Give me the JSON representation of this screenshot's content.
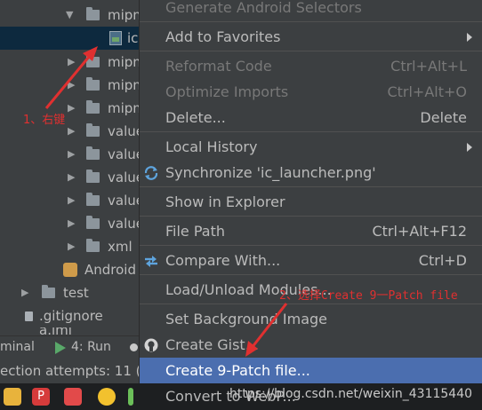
{
  "project_tree": {
    "rows": [
      {
        "label": "mipm"
      },
      {
        "label": "ic"
      },
      {
        "label": "mipm"
      },
      {
        "label": "mipm"
      },
      {
        "label": "mipm"
      },
      {
        "label": "value"
      },
      {
        "label": "value"
      },
      {
        "label": "value"
      },
      {
        "label": "value"
      },
      {
        "label": "value"
      },
      {
        "label": "xml"
      },
      {
        "label": "Android"
      },
      {
        "label": "test"
      },
      {
        "label": ".gitignore"
      },
      {
        "label": "a.iml"
      }
    ]
  },
  "tool_strip": {
    "terminal": "minal",
    "run": "4: Run"
  },
  "status_bar": {
    "text": "ection attempts: 11 ("
  },
  "context_menu": {
    "items": [
      {
        "label": "Generate Android Selectors",
        "enabled": false
      },
      {
        "label": "Add to Favorites",
        "submenu": true
      },
      {
        "label": "Reformat Code",
        "shortcut": "Ctrl+Alt+L",
        "enabled": false
      },
      {
        "label": "Optimize Imports",
        "shortcut": "Ctrl+Alt+O",
        "enabled": false
      },
      {
        "label": "Delete...",
        "shortcut": "Delete"
      },
      {
        "label": "Local History",
        "submenu": true
      },
      {
        "label": "Synchronize 'ic_launcher.png'",
        "icon": "sync-icon"
      },
      {
        "label": "Show in Explorer"
      },
      {
        "label": "File Path",
        "shortcut": "Ctrl+Alt+F12"
      },
      {
        "label": "Compare With...",
        "shortcut": "Ctrl+D",
        "icon": "compare-icon"
      },
      {
        "label": "Load/Unload Modules..."
      },
      {
        "label": "Set Background Image"
      },
      {
        "label": "Create Gist...",
        "icon": "github-icon"
      },
      {
        "label": "Create 9-Patch file...",
        "highlighted": true
      },
      {
        "label": "Convert to WebP..."
      }
    ]
  },
  "annotations": {
    "step1": "1、右键",
    "step2": "2、选择Create 9一Patch file"
  },
  "watermark": "https://blog.csdn.net/weixin_43115440",
  "colors": {
    "menu_bg": "#3c3f41",
    "highlight": "#4b6eaf",
    "selection": "#0d293e",
    "annotation": "#e03030"
  }
}
